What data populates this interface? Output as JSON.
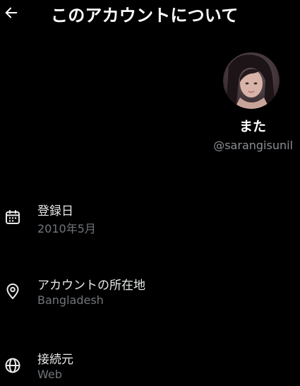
{
  "header": {
    "title": "このアカウントについて",
    "back_icon": "arrow-left-icon"
  },
  "profile": {
    "display_name": "また",
    "handle": "@sarangisunil",
    "avatar": "profile-photo"
  },
  "info": [
    {
      "icon": "calendar-icon",
      "label": "登録日",
      "value": "2010年5月"
    },
    {
      "icon": "location-pin-icon",
      "label": "アカウントの所在地",
      "value": "Bangladesh"
    },
    {
      "icon": "globe-icon",
      "label": "接続元",
      "value": "Web"
    }
  ],
  "colors": {
    "background": "#000000",
    "primary_text": "#e7e9ea",
    "secondary_text": "#71767b"
  }
}
